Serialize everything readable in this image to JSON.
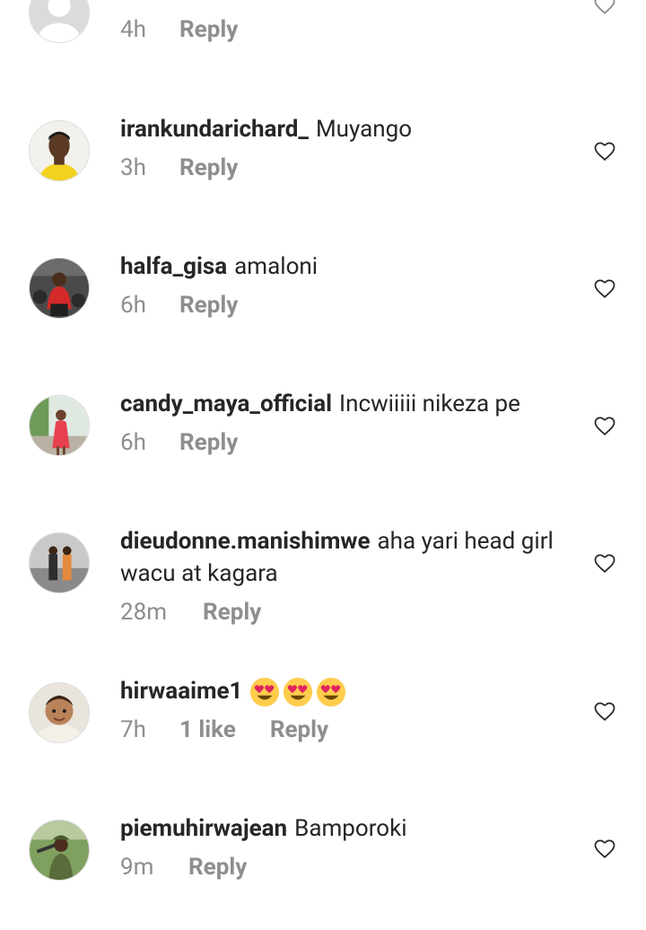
{
  "comments": [
    {
      "username": "",
      "text": "",
      "time": "4h",
      "likes": "",
      "reply": "Reply",
      "avatar": "default-avatar"
    },
    {
      "username": "irankundarichard_",
      "text": "Muyango",
      "time": "3h",
      "likes": "",
      "reply": "Reply",
      "avatar": "man-yellow-shirt"
    },
    {
      "username": "halfa_gisa",
      "text": "amaloni",
      "time": "6h",
      "likes": "",
      "reply": "Reply",
      "avatar": "man-red-jacket"
    },
    {
      "username": "candy_maya_official",
      "text": "Incwiiiii nikeza pe",
      "time": "6h",
      "likes": "",
      "reply": "Reply",
      "avatar": "woman-red-dress"
    },
    {
      "username": "dieudonne.manishimwe",
      "text": "aha yari head girl wacu at kagara",
      "time": "28m",
      "likes": "",
      "reply": "Reply",
      "avatar": "group-photo"
    },
    {
      "username": "hirwaaime1",
      "text": "",
      "emoji": [
        "heart-eyes",
        "heart-eyes",
        "heart-eyes"
      ],
      "time": "7h",
      "likes": "1 like",
      "reply": "Reply",
      "avatar": "baby-photo"
    },
    {
      "username": "piemuhirwajean",
      "text": "Bamporoki",
      "time": "9m",
      "likes": "",
      "reply": "Reply",
      "avatar": "soldier-photo"
    }
  ],
  "colors": {
    "text": "#262626",
    "meta": "#8e8e8e",
    "background": "#ffffff"
  }
}
